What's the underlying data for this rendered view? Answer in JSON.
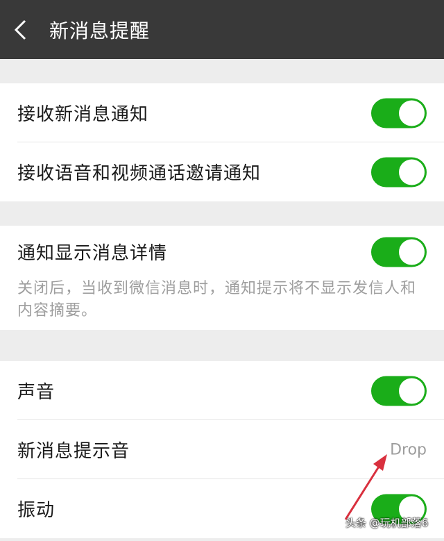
{
  "header": {
    "title": "新消息提醒"
  },
  "group1": [
    {
      "label": "接收新消息通知",
      "toggle": true
    },
    {
      "label": "接收语音和视频通话邀请通知",
      "toggle": true
    }
  ],
  "group2": {
    "label": "通知显示消息详情",
    "toggle": true,
    "description": "关闭后，当收到微信消息时，通知提示将不显示发信人和内容摘要。"
  },
  "group3": [
    {
      "label": "声音",
      "toggle": true
    },
    {
      "label": "新消息提示音",
      "value": "Drop"
    },
    {
      "label": "振动",
      "toggle": true
    }
  ],
  "watermark": "头条 @玩机部落6",
  "colors": {
    "header_bg": "#393939",
    "toggle_on": "#1aad19",
    "page_bg": "#ededed",
    "annotation_arrow": "#d9303e"
  }
}
